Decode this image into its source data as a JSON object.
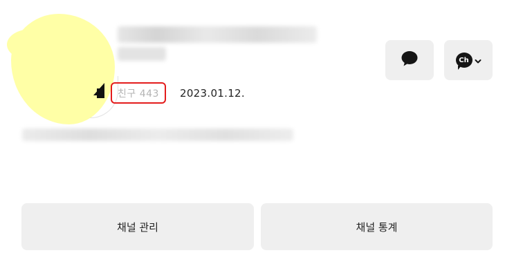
{
  "profile": {
    "friends_label": "친구 443",
    "created_date": "2023.01.12."
  },
  "actions": {
    "chat_icon": "chat-bubble-icon",
    "channel_icon": "channel-ch-icon",
    "channel_badge_text": "Ch",
    "chevron_icon": "chevron-down-icon"
  },
  "buttons": {
    "manage_label": "채널 관리",
    "stats_label": "채널 통계"
  },
  "colors": {
    "highlight_border": "#e31b1b",
    "button_bg": "#efefef",
    "avatar_fill": "#ffffa6"
  }
}
